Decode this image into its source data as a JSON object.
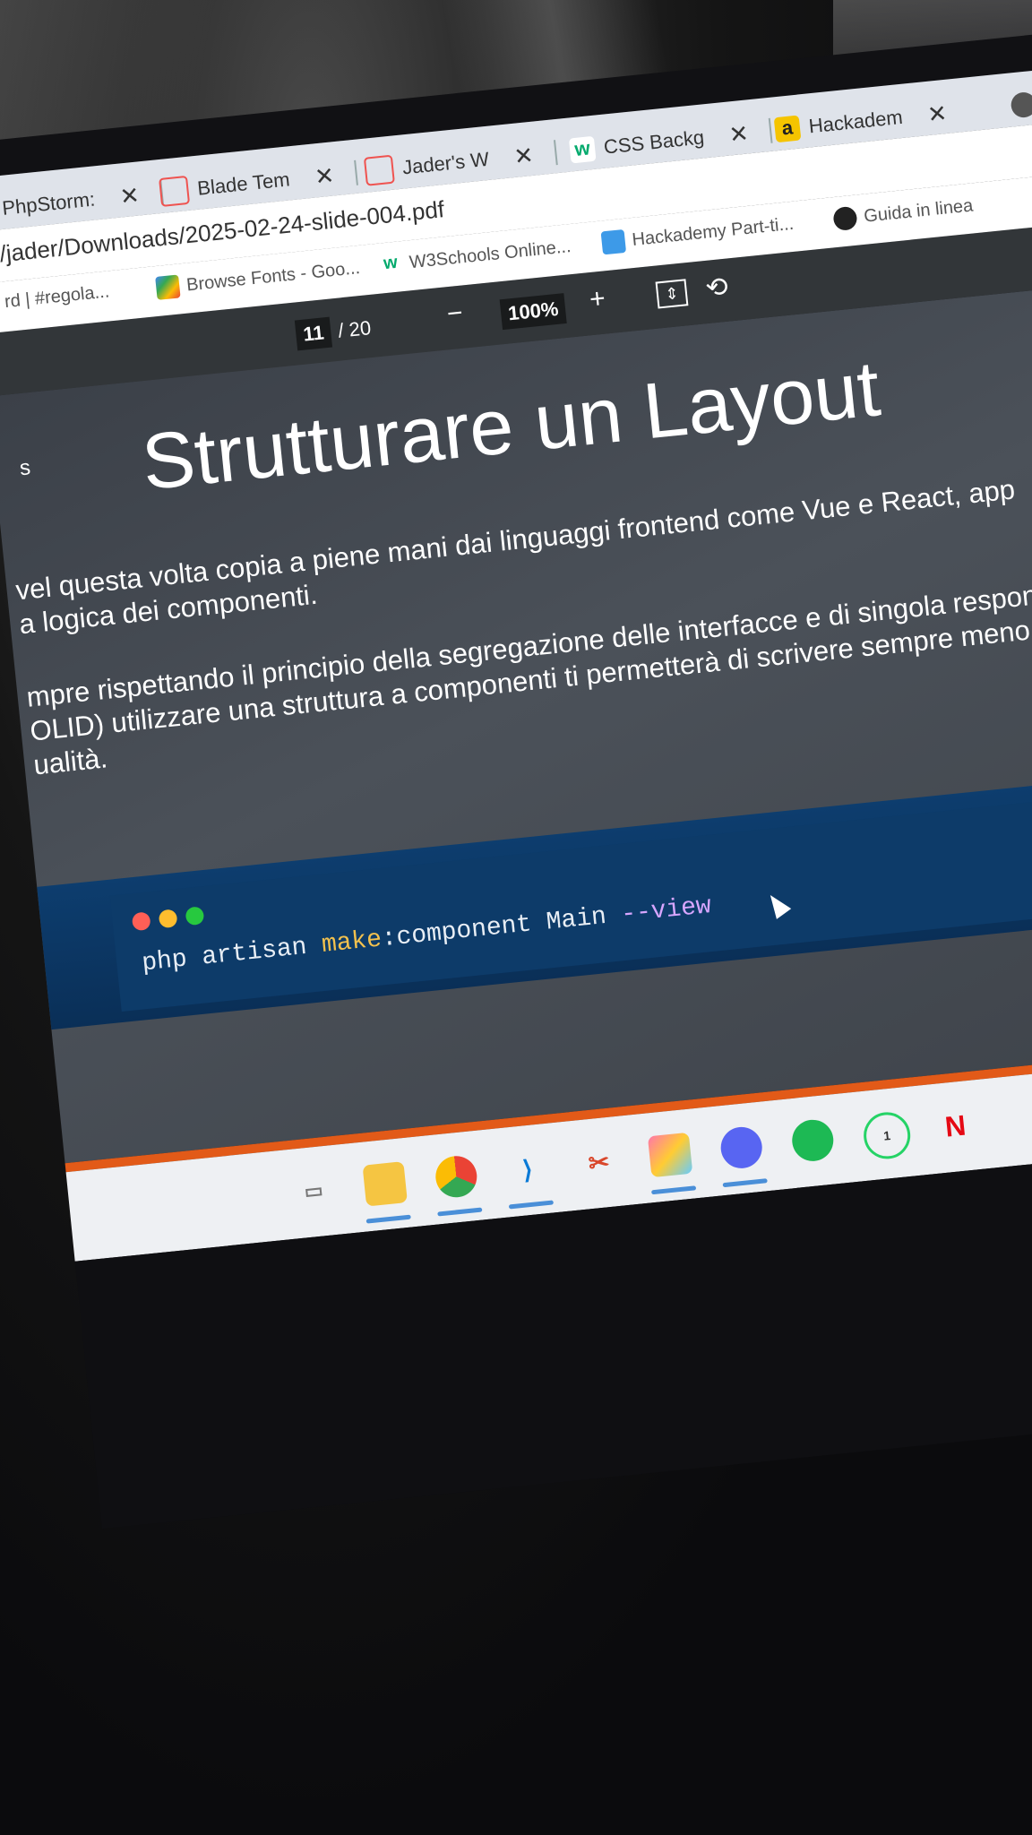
{
  "browser": {
    "tabs": [
      {
        "label": "PhpStorm:",
        "icon": "phpstorm-icon"
      },
      {
        "label": "Blade Tem",
        "icon": "laravel-icon"
      },
      {
        "label": "Jader's W",
        "icon": "laravel-icon"
      },
      {
        "label": "CSS Backg",
        "icon": "w3schools-icon"
      },
      {
        "label": "Hackadem",
        "icon": "amazon-icon"
      }
    ],
    "url": "/jader/Downloads/2025-02-24-slide-004.pdf",
    "bookmarks": [
      {
        "label": "rd | #regola...",
        "icon": "bookmark-icon"
      },
      {
        "label": "Browse Fonts - Goo...",
        "icon": "google-fonts-icon"
      },
      {
        "label": "W3Schools Online...",
        "icon": "w3schools-icon"
      },
      {
        "label": "Hackademy Part-ti...",
        "icon": "dropbox-icon"
      },
      {
        "label": "Guida in linea",
        "icon": "github-icon"
      }
    ]
  },
  "pdf_toolbar": {
    "current_page": "11",
    "total_pages": "/ 20",
    "zoom": "100%",
    "zoom_out": "−",
    "zoom_in": "+"
  },
  "slide": {
    "side_label": "s",
    "title": "Strutturare un Layout",
    "paragraph1_line1": "vel questa volta copia a piene mani dai linguaggi frontend come Vue e React, app",
    "paragraph1_line2": "a logica dei componenti.",
    "paragraph2_line1": "mpre rispettando il principio della segregazione delle interfacce e di singola respon",
    "paragraph2_line2": "OLID) utilizzare una struttura a componenti ti permetterà di scrivere sempre meno",
    "paragraph2_line3": "ualità.",
    "code": {
      "part1": "php artisan ",
      "part2": "make",
      "part3": ":component Main ",
      "part4": "--view"
    }
  },
  "taskbar": {
    "whatsapp_badge": "1",
    "apps": [
      "task-view-icon",
      "file-explorer-icon",
      "chrome-icon",
      "vscode-icon",
      "snipping-tool-icon",
      "photos-icon",
      "discord-icon",
      "spotify-icon",
      "whatsapp-icon",
      "netflix-icon"
    ]
  },
  "colors": {
    "accent_orange": "#e25a18",
    "code_blue": "#0d3b69",
    "pdf_toolbar": "#323639",
    "slide_bg": "#454a52"
  }
}
